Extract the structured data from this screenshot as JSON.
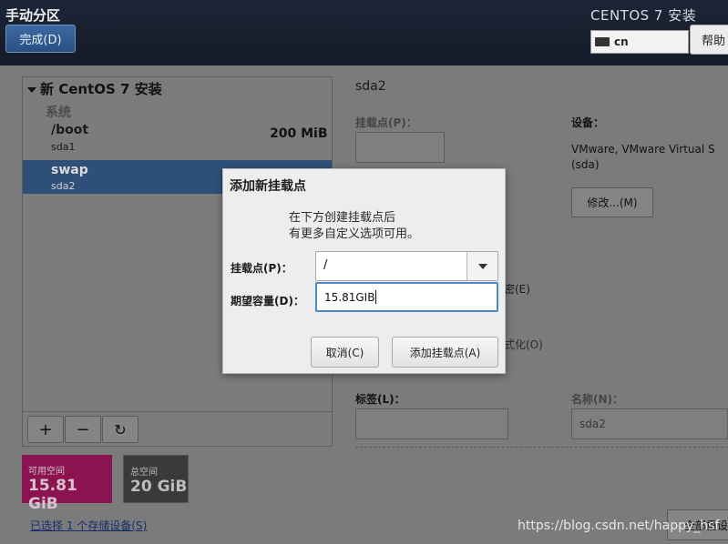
{
  "header": {
    "title": "手动分区",
    "done_button": "完成(D)",
    "product": "CENTOS 7 安装",
    "keyboard_layout": "cn",
    "help_button": "帮助"
  },
  "partition_list": {
    "install_title": "新 CentOS 7 安装",
    "group_label": "系统",
    "rows": [
      {
        "mount": "/boot",
        "device": "sda1",
        "size": "200 MiB"
      },
      {
        "mount": "swap",
        "device": "sda2"
      }
    ],
    "toolbar": {
      "add": "+",
      "remove": "−",
      "refresh": "↻"
    }
  },
  "space": {
    "available_label": "可用空间",
    "available_value": "15.81 GiB",
    "total_label": "总空间",
    "total_value": "20 GiB",
    "available_color": "#8a1350"
  },
  "storage_link": "已选择 1 个存储设备(S)",
  "details": {
    "title": "sda2",
    "mount_label": "挂载点(P)：",
    "device_label": "设备：",
    "device_value": "VMware, VMware Virtual S (sda)",
    "modify_button": "修改...(M)",
    "encrypt_fragment": "密(E)",
    "format_fragment": "式化(O)",
    "tag_label": "标签(L)：",
    "name_label": "名称(N)：",
    "name_value": "sda2",
    "reset_fragment": "全部重设"
  },
  "dialog": {
    "title": "添加新挂载点",
    "desc_line1": "在下方创建挂载点后",
    "desc_line2": "有更多自定义选项可用。",
    "mount_label": "挂载点(P)：",
    "mount_value": "/",
    "capacity_label": "期望容量(D)：",
    "capacity_value": "15.81GIB",
    "cancel_button": "取消(C)",
    "add_button": "添加挂载点(A)"
  },
  "watermark": "https://blog.csdn.net/happy_hsf"
}
